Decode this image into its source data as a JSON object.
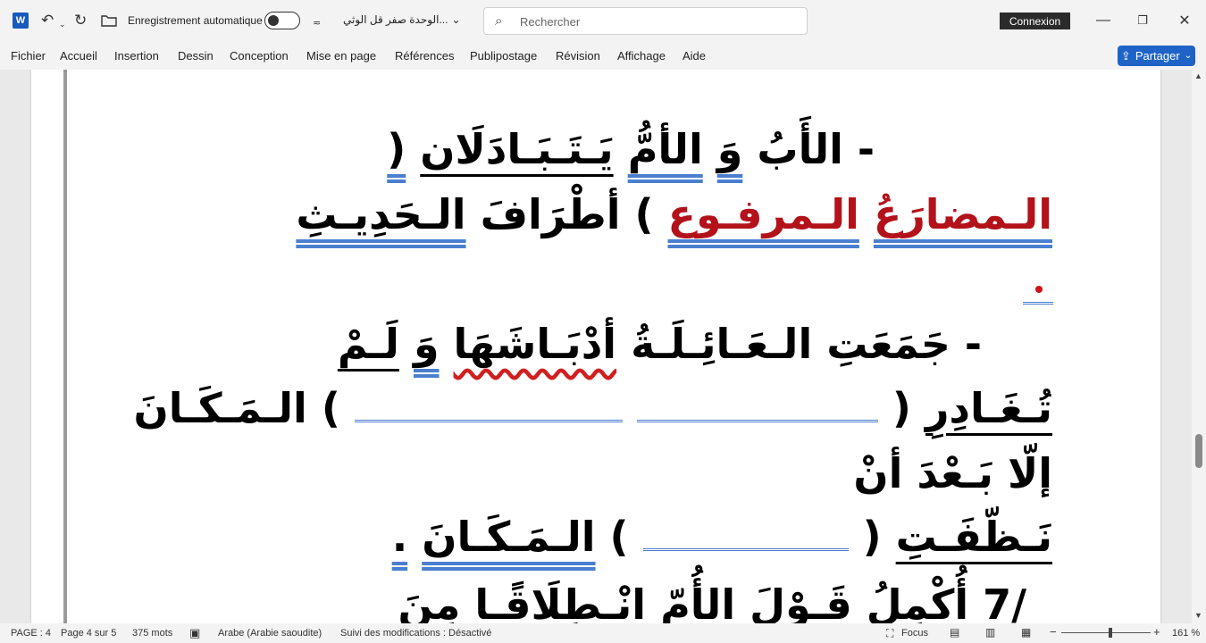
{
  "titlebar": {
    "app_logo": "W",
    "autosave_label": "Enregistrement automatique",
    "document_title": "الوحدة صفر قل الوثي...",
    "search_placeholder": "Rechercher",
    "connexion_label": "Connexion",
    "icons": [
      "undo-icon",
      "redo-icon",
      "folder-icon",
      "chevron-down-icon",
      "search-icon",
      "minimize-icon",
      "restore-icon",
      "close-icon"
    ]
  },
  "ribbon": {
    "tabs": [
      "Fichier",
      "Accueil",
      "Insertion",
      "Dessin",
      "Conception",
      "Mise en page",
      "Références",
      "Publipostage",
      "Révision",
      "Affichage",
      "Aide"
    ],
    "share_label": "Partager"
  },
  "document": {
    "line1": {
      "dash": "-",
      "w1": "الأَبُ",
      "w2": "وَ",
      "w3": "الأمُّ",
      "w4": "يَـتَـبَـادَلَان",
      "paren": "("
    },
    "line2": {
      "w1": "الـمضارَعُ",
      "w2": "الـمرفـوع",
      "paren": ")",
      "w3": "أطْرَافَ",
      "w4": "الـحَدِيـثِ"
    },
    "line3": {
      "dash": "-",
      "w1": "جَمَعَتِ",
      "w2": "الـعَـائِـلَـةُ",
      "w3": "أدْبَـاشَهَا",
      "w4": "وَ",
      "w5": "لَـمْ"
    },
    "line4": {
      "w1": "تُـغَـادِرِ",
      "paren_open": "(",
      "paren_close": ")",
      "w2": "الـمَـكَـانَ"
    },
    "line5": {
      "w1": "إلّا",
      "w2": "بَـعْدَ",
      "w3": "أنْ"
    },
    "line6": {
      "w1": "نَـظّفَـتِ",
      "paren_open": "(",
      "paren_close": ")",
      "w2": "الـمَـكَـانَ",
      "period": "."
    },
    "line7": {
      "num": "/7",
      "w1": "أُكْمِلُ",
      "w2": "قَـوْلَ",
      "w3": "الأُمّ",
      "w4": "انْـطِلَاقًـا",
      "w5": "مِنَ"
    }
  },
  "statusbar": {
    "page": "PAGE : 4",
    "page_of": "Page 4 sur 5",
    "words": "375 mots",
    "language": "Arabe (Arabie saoudite)",
    "track_changes": "Suivi des modifications : Désactivé",
    "focus": "Focus",
    "zoom": "161 %"
  }
}
